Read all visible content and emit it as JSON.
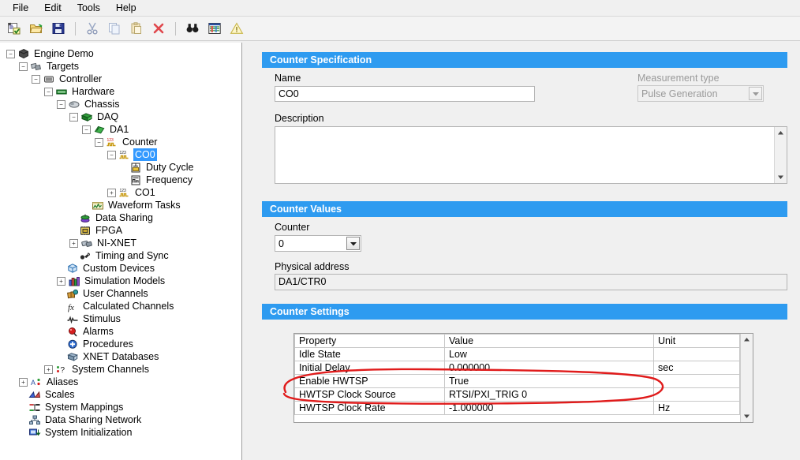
{
  "menu": {
    "items": [
      {
        "label": "File"
      },
      {
        "label": "Edit"
      },
      {
        "label": "Tools"
      },
      {
        "label": "Help"
      }
    ]
  },
  "toolbar": {
    "buttons": [
      {
        "name": "new-project-icon",
        "title": "New"
      },
      {
        "name": "open-folder-icon",
        "title": "Open"
      },
      {
        "name": "save-icon",
        "title": "Save"
      },
      {
        "name": "cut-icon",
        "title": "Cut"
      },
      {
        "name": "copy-icon",
        "title": "Copy"
      },
      {
        "name": "paste-icon",
        "title": "Paste"
      },
      {
        "name": "delete-icon",
        "title": "Delete"
      },
      {
        "name": "find-icon",
        "title": "Find"
      },
      {
        "name": "channel-list-icon",
        "title": "Channels"
      },
      {
        "name": "warning-icon",
        "title": "Warnings"
      }
    ]
  },
  "tree": {
    "items": [
      {
        "label": "Engine Demo",
        "depth": 0,
        "expander": "minus",
        "icon": "project-icon",
        "selected": false
      },
      {
        "label": "Targets",
        "depth": 1,
        "expander": "minus",
        "icon": "targets-icon",
        "selected": false
      },
      {
        "label": "Controller",
        "depth": 2,
        "expander": "minus",
        "icon": "controller-icon",
        "selected": false
      },
      {
        "label": "Hardware",
        "depth": 3,
        "expander": "minus",
        "icon": "hardware-icon",
        "selected": false
      },
      {
        "label": "Chassis",
        "depth": 4,
        "expander": "minus",
        "icon": "chassis-icon",
        "selected": false
      },
      {
        "label": "DAQ",
        "depth": 5,
        "expander": "minus",
        "icon": "daq-icon",
        "selected": false
      },
      {
        "label": "DA1",
        "depth": 6,
        "expander": "minus",
        "icon": "device-icon",
        "selected": false
      },
      {
        "label": "Counter",
        "depth": 7,
        "expander": "minus",
        "icon": "counter-icon",
        "selected": false
      },
      {
        "label": "CO0",
        "depth": 8,
        "expander": "minus",
        "icon": "counter-chan-icon",
        "selected": true
      },
      {
        "label": "Duty Cycle",
        "depth": 9,
        "expander": "none",
        "icon": "duty-cycle-icon",
        "selected": false
      },
      {
        "label": "Frequency",
        "depth": 9,
        "expander": "none",
        "icon": "frequency-icon",
        "selected": false
      },
      {
        "label": "CO1",
        "depth": 8,
        "expander": "plus",
        "icon": "counter-chan-icon",
        "selected": false
      },
      {
        "label": "Waveform Tasks",
        "depth": 6,
        "expander": "none",
        "icon": "waveform-icon",
        "selected": false
      },
      {
        "label": "Data Sharing",
        "depth": 5,
        "expander": "none",
        "icon": "data-sharing-icon",
        "selected": false
      },
      {
        "label": "FPGA",
        "depth": 5,
        "expander": "none",
        "icon": "fpga-icon",
        "selected": false
      },
      {
        "label": "NI-XNET",
        "depth": 5,
        "expander": "plus",
        "icon": "nixnet-icon",
        "selected": false
      },
      {
        "label": "Timing and Sync",
        "depth": 5,
        "expander": "none",
        "icon": "timing-sync-icon",
        "selected": false
      },
      {
        "label": "Custom Devices",
        "depth": 4,
        "expander": "none",
        "icon": "custom-device-icon",
        "selected": false
      },
      {
        "label": "Simulation Models",
        "depth": 4,
        "expander": "plus",
        "icon": "sim-models-icon",
        "selected": false
      },
      {
        "label": "User Channels",
        "depth": 4,
        "expander": "none",
        "icon": "user-channels-icon",
        "selected": false
      },
      {
        "label": "Calculated Channels",
        "depth": 4,
        "expander": "none",
        "icon": "calc-channels-icon",
        "selected": false
      },
      {
        "label": "Stimulus",
        "depth": 4,
        "expander": "none",
        "icon": "stimulus-icon",
        "selected": false
      },
      {
        "label": "Alarms",
        "depth": 4,
        "expander": "none",
        "icon": "alarms-icon",
        "selected": false
      },
      {
        "label": "Procedures",
        "depth": 4,
        "expander": "none",
        "icon": "procedures-icon",
        "selected": false
      },
      {
        "label": "XNET Databases",
        "depth": 4,
        "expander": "none",
        "icon": "xnet-db-icon",
        "selected": false
      },
      {
        "label": "System Channels",
        "depth": 3,
        "expander": "plus",
        "icon": "sys-channels-icon",
        "selected": false
      },
      {
        "label": "Aliases",
        "depth": 1,
        "expander": "plus",
        "icon": "aliases-icon",
        "selected": false
      },
      {
        "label": "Scales",
        "depth": 1,
        "expander": "none",
        "icon": "scales-icon",
        "selected": false
      },
      {
        "label": "System Mappings",
        "depth": 1,
        "expander": "none",
        "icon": "sys-mappings-icon",
        "selected": false
      },
      {
        "label": "Data Sharing Network",
        "depth": 1,
        "expander": "none",
        "icon": "data-net-icon",
        "selected": false
      },
      {
        "label": "System Initialization",
        "depth": 1,
        "expander": "none",
        "icon": "sys-init-icon",
        "selected": false
      }
    ]
  },
  "counter_specification": {
    "header": "Counter Specification",
    "name_label": "Name",
    "name_value": "CO0",
    "measurement_type_label": "Measurement type",
    "measurement_type_value": "Pulse Generation",
    "measurement_type_options": [
      "Pulse Generation"
    ],
    "description_label": "Description",
    "description_value": ""
  },
  "counter_values": {
    "header": "Counter Values",
    "counter_label": "Counter",
    "counter_value": "0",
    "counter_options": [
      "0"
    ],
    "physical_address_label": "Physical address",
    "physical_address_value": "DA1/CTR0"
  },
  "counter_settings": {
    "header": "Counter Settings",
    "columns": [
      "Property",
      "Value",
      "Unit"
    ],
    "rows": [
      {
        "property": "Idle State",
        "value": "Low",
        "unit": ""
      },
      {
        "property": "Initial Delay",
        "value": "0.000000",
        "unit": "sec"
      },
      {
        "property": "Enable HWTSP",
        "value": "True",
        "unit": ""
      },
      {
        "property": "HWTSP Clock Source",
        "value": "RTSI/PXI_TRIG 0",
        "unit": ""
      },
      {
        "property": "HWTSP Clock Rate",
        "value": "-1.000000",
        "unit": "Hz"
      }
    ]
  },
  "annotation": {
    "name": "red-ellipse-highlight",
    "color": "#e01b1b",
    "target_rows": [
      "Enable HWTSP",
      "HWTSP Clock Source"
    ]
  },
  "colors": {
    "accent_header": "#2e9bf0",
    "selection": "#3399ff",
    "panel_bg": "#f0f0f0",
    "annotation_red": "#e01b1b"
  }
}
